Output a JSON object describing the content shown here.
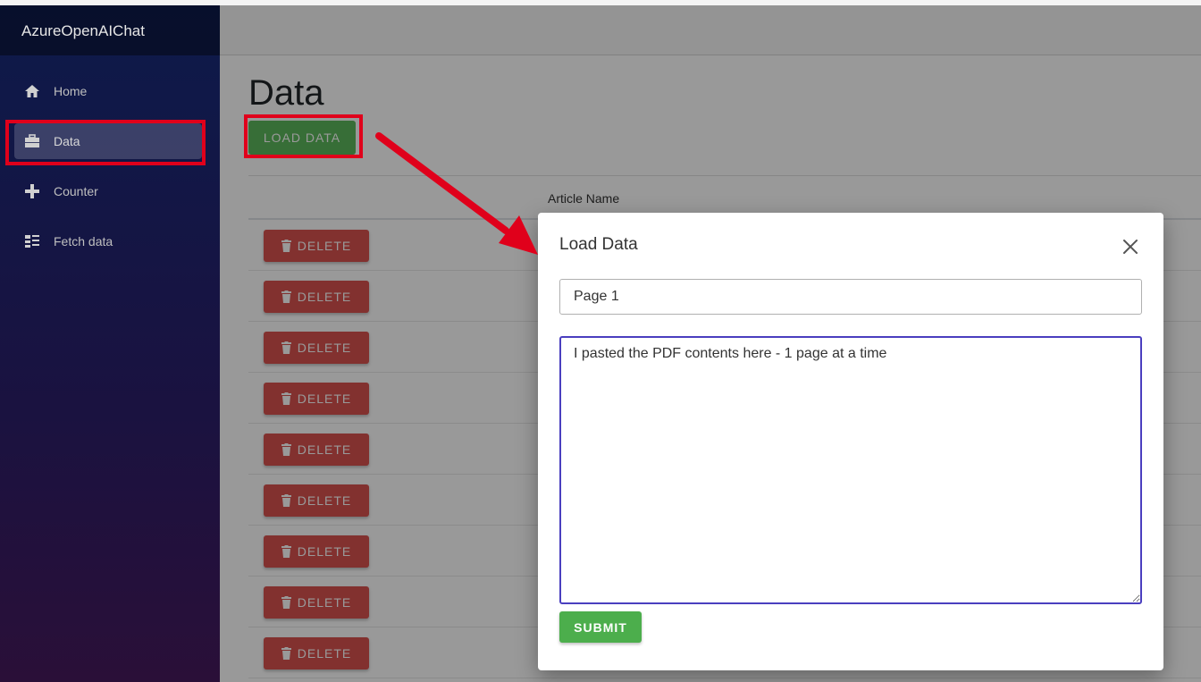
{
  "app": {
    "brand": "AzureOpenAIChat"
  },
  "sidebar": {
    "items": [
      {
        "label": "Home",
        "icon": "home-icon"
      },
      {
        "label": "Data",
        "icon": "briefcase-icon",
        "active": true
      },
      {
        "label": "Counter",
        "icon": "plus-icon"
      },
      {
        "label": "Fetch data",
        "icon": "list-icon"
      }
    ]
  },
  "page": {
    "title": "Data",
    "load_button": "LOAD DATA",
    "table": {
      "columns": [
        "",
        "Article Name"
      ],
      "rows": [
        {
          "delete_label": "DELETE"
        },
        {
          "delete_label": "DELETE"
        },
        {
          "delete_label": "DELETE"
        },
        {
          "delete_label": "DELETE"
        },
        {
          "delete_label": "DELETE"
        },
        {
          "delete_label": "DELETE"
        },
        {
          "delete_label": "DELETE"
        },
        {
          "delete_label": "DELETE"
        },
        {
          "delete_label": "DELETE"
        }
      ]
    }
  },
  "modal": {
    "title": "Load Data",
    "title_field_value": "Page 1",
    "content_field_value": "I pasted the PDF contents here - 1 page at a time",
    "submit_label": "SUBMIT"
  },
  "colors": {
    "success": "#5cb85c",
    "danger": "#d9534f",
    "annotation": "#e0001b",
    "focus": "#4a3fbf"
  }
}
